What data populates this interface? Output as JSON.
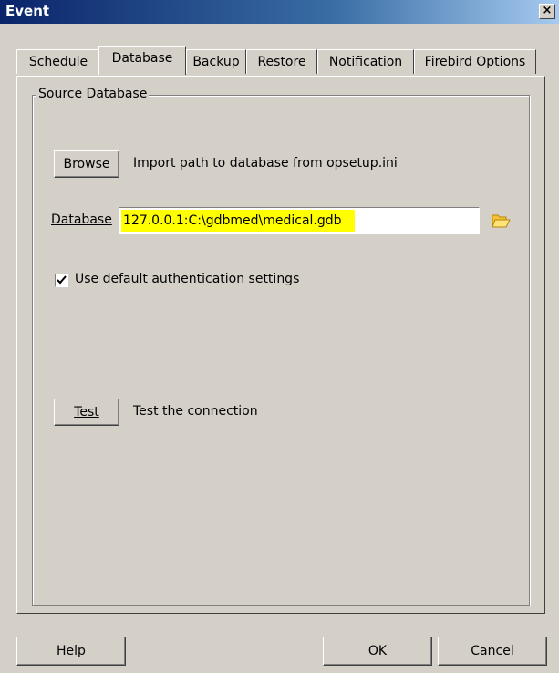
{
  "window": {
    "title": "Event",
    "close_glyph": "×"
  },
  "tabs": [
    {
      "label": "Schedule",
      "active": false
    },
    {
      "label": "Database",
      "active": true
    },
    {
      "label": "Backup",
      "active": false
    },
    {
      "label": "Restore",
      "active": false
    },
    {
      "label": "Notification",
      "active": false
    },
    {
      "label": "Firebird Options",
      "active": false
    }
  ],
  "source_database": {
    "group_label": "Source Database",
    "browse_label": "Browse",
    "browse_description": "Import path to database from opsetup.ini",
    "database_label": "Database",
    "database_value": "127.0.0.1:C:\\gdbmed\\medical.gdb",
    "database_highlight": "#ffff00",
    "folder_icon": "folder-open-icon",
    "auth_checkbox_label": "Use default authentication settings",
    "auth_checked": true,
    "test_label": "Test",
    "test_description": "Test the connection"
  },
  "footer": {
    "help_label": "Help",
    "ok_label": "OK",
    "cancel_label": "Cancel"
  }
}
